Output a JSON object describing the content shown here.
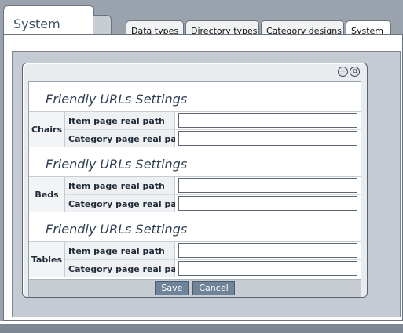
{
  "main_tab": {
    "label": "System"
  },
  "sub_tabs": [
    {
      "label": "Data types"
    },
    {
      "label": "Directory types"
    },
    {
      "label": "Category designs"
    },
    {
      "label": "System"
    }
  ],
  "dialog": {
    "sections": [
      {
        "title": "Friendly URLs Settings",
        "group": "Chairs",
        "fields": [
          {
            "label": "Item page real path",
            "value": ""
          },
          {
            "label": "Category page real path",
            "value": ""
          }
        ]
      },
      {
        "title": "Friendly URLs Settings",
        "group": "Beds",
        "fields": [
          {
            "label": "Item page real path",
            "value": ""
          },
          {
            "label": "Category page real path",
            "value": ""
          }
        ]
      },
      {
        "title": "Friendly URLs Settings",
        "group": "Tables",
        "fields": [
          {
            "label": "Item page real path",
            "value": ""
          },
          {
            "label": "Category page real path",
            "value": ""
          }
        ]
      }
    ],
    "buttons": {
      "save": "Save",
      "cancel": "Cancel"
    },
    "window_controls": [
      "minimize-icon",
      "restore-icon"
    ]
  },
  "colors": {
    "button_bg": "#6f8399",
    "page_bg": "#9aa3ad",
    "panel_bg": "#c5cbd3"
  }
}
